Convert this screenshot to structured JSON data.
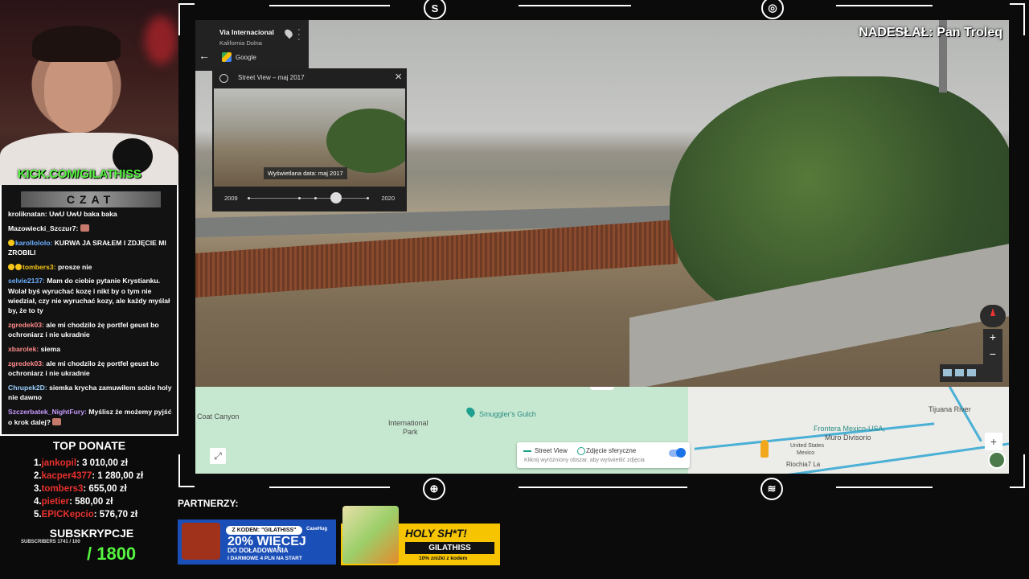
{
  "webcam": {
    "channel_url": "KICK.COM/GILATHISS"
  },
  "chat": {
    "title": "CZAT",
    "messages": [
      {
        "user": "kroliknatan:",
        "user_color": "#ffffff",
        "text": "UwU UwU baka baka"
      },
      {
        "user": "Mazowiecki_Szczur7:",
        "user_color": "#ffffff",
        "text": ""
      },
      {
        "user": "karollololo:",
        "user_color": "#6db0ff",
        "text": "KURWA JA SRAŁEM I ZDJĘCIE MI ZROBILI"
      },
      {
        "user": "tombers3:",
        "user_color": "#f5c518",
        "text": "prosze nie"
      },
      {
        "user": "selvie2137:",
        "user_color": "#6db0ff",
        "text": "Mam do ciebie pytanie Krystianku. Wolał byś wyruchać kozę i nikt by o tym nie wiedział, czy nie wyruchać kozy, ale każdy myślał by, że to ty"
      },
      {
        "user": "zgredek03:",
        "user_color": "#ff8a8a",
        "text": "ale mi chodzilo żę portfel geust bo ochroniarz i nie ukradnie"
      },
      {
        "user": "xbarolek:",
        "user_color": "#ff8a8a",
        "text": "siema"
      },
      {
        "user": "zgredek03:",
        "user_color": "#ff8a8a",
        "text": "ale mi chodzilo żę portfel geust bo ochroniarz i nie ukradnie"
      },
      {
        "user": "Chrupek2D:",
        "user_color": "#9ad0ff",
        "text": "siemka krycha zamuwiłem sobie holy nie dawno"
      },
      {
        "user": "Szczerbatek_NightFury:",
        "user_color": "#c79bff",
        "text": "Myślisz że możemy pyjść o krok dalej?"
      }
    ]
  },
  "top_donate": {
    "title": "TOP DONATE",
    "rows": [
      {
        "rank": "1.",
        "name": "jankopil",
        "amount": ": 3 010,00 zł"
      },
      {
        "rank": "2.",
        "name": "kacper4377",
        "amount": ": 1 280,00 zł"
      },
      {
        "rank": "3.",
        "name": "tombers3",
        "amount": ": 655,00 zł"
      },
      {
        "rank": "4.",
        "name": "pietier",
        "amount": ": 580,00 zł"
      },
      {
        "rank": "5.",
        "name": "EPICKepcio",
        "amount": ": 576,70 zł"
      }
    ]
  },
  "subs": {
    "title": "SUBSKRYPCJE",
    "small": "SUBSCRIBERS 1741 / 100",
    "goal": "/ 1800"
  },
  "submission": {
    "credit": "NADESŁAŁ: Pan Troleq"
  },
  "streetview": {
    "place_name": "Via Internacional",
    "place_sub": "Kalifornia Dolna",
    "google_label": "Google",
    "time_title": "Street View – maj 2017",
    "thumb_date": "Wyświetlana data: maj 2017",
    "year_start": "2009",
    "year_end": "2020",
    "slider_position": 0.73
  },
  "map": {
    "labels": {
      "coat_canyon": "Coat Canyon",
      "international_park_1": "International",
      "international_park_2": "Park",
      "smugglers_gulch": "Smuggler's Gulch",
      "tijuana_river": "Tijuana River",
      "frontera_1": "Frontera Mexico-USA,",
      "frontera_2": "Muro Divisorio",
      "united_states": "United States",
      "mexico": "Mexico",
      "riochia": "Riochia7 La"
    },
    "toggle": {
      "street_view": "Street View",
      "spherical": "Zdjęcie sferyczne",
      "hint": "Kliknij wyróżniony obszar, aby wyświetlić zdjęcia"
    }
  },
  "partners": {
    "title": "PARTNERZY:",
    "banner1": {
      "code_pill": "Z KODEM: \"GILATHISS\"",
      "big": "20% WIĘCEJ",
      "line2": "DO DOŁADOWANIA",
      "small": "I DARMOWE 4 PLN NA START",
      "brand": "CaseHug"
    },
    "banner2": {
      "headline": "HOLY SH*T!",
      "code": "GILATHISS",
      "discount": "10% zniżki z kodem"
    }
  },
  "colors": {
    "kick_green": "#54f43f",
    "donor_red": "#e8302d",
    "frame": "#ffffff"
  }
}
